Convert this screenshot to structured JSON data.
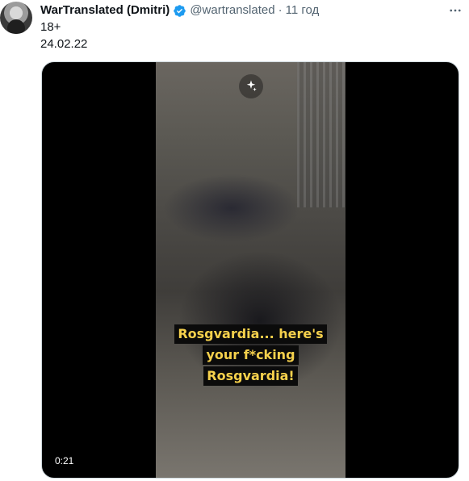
{
  "tweet": {
    "author_name": "WarTranslated (Dmitri)",
    "handle": "@wartranslated",
    "separator": "·",
    "time": "11 год",
    "line1": "18+",
    "line2": "24.02.22"
  },
  "media": {
    "subtitle_lines": [
      "Rosgvardia... here's",
      "your f*cking",
      "Rosgvardia!"
    ],
    "timecode": "0:21"
  },
  "icons": {
    "verified": "verified-badge-icon",
    "more": "more-options-icon",
    "sparkle": "sparkle-icon"
  },
  "colors": {
    "verified": "#1d9bf0",
    "subtitle_text": "#f6d14c",
    "muted_text": "#536471"
  }
}
